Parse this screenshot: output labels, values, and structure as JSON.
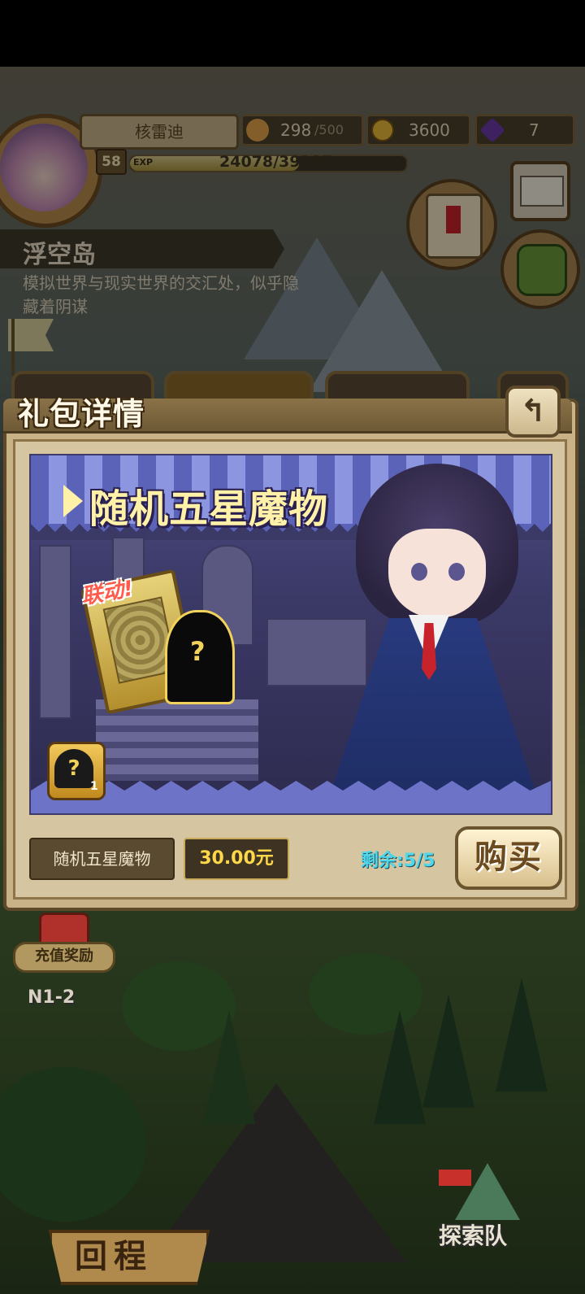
{
  "player": {
    "name": "核雷迪",
    "level": "58",
    "exp_label": "EXP",
    "exp_text": "24078/39287",
    "exp_fraction": 0.613
  },
  "resources": {
    "stamina_value": "298",
    "stamina_max": "/500",
    "gold": "3600",
    "gems": "7"
  },
  "location": {
    "title": "浮空岛",
    "description": "模拟世界与现实世界的交汇处，似乎隐藏着阴谋"
  },
  "modal": {
    "title": "礼包详情",
    "back_icon": "↰",
    "banner_title": "随机五星魔物",
    "collab_label": "联动!",
    "badge_count": "1",
    "item_name": "随机五星魔物",
    "price": "30.00元",
    "remaining": "剩余:5/5",
    "buy_label": "购买"
  },
  "lower": {
    "recharge_label": "充值奖励",
    "recharge_stage": "N1-2",
    "return_label": "回程",
    "explore_label": "探索队"
  },
  "colors": {
    "gold_text": "#ffd84a",
    "remaining_text": "#4fd8ec",
    "modal_frame": "#c9b288"
  },
  "icons": [
    "bread-icon",
    "coin-icon",
    "gem-icon",
    "mail-icon",
    "quest-scroll-icon",
    "backpack-icon",
    "back-arrow-icon",
    "paw-flag-icon"
  ]
}
